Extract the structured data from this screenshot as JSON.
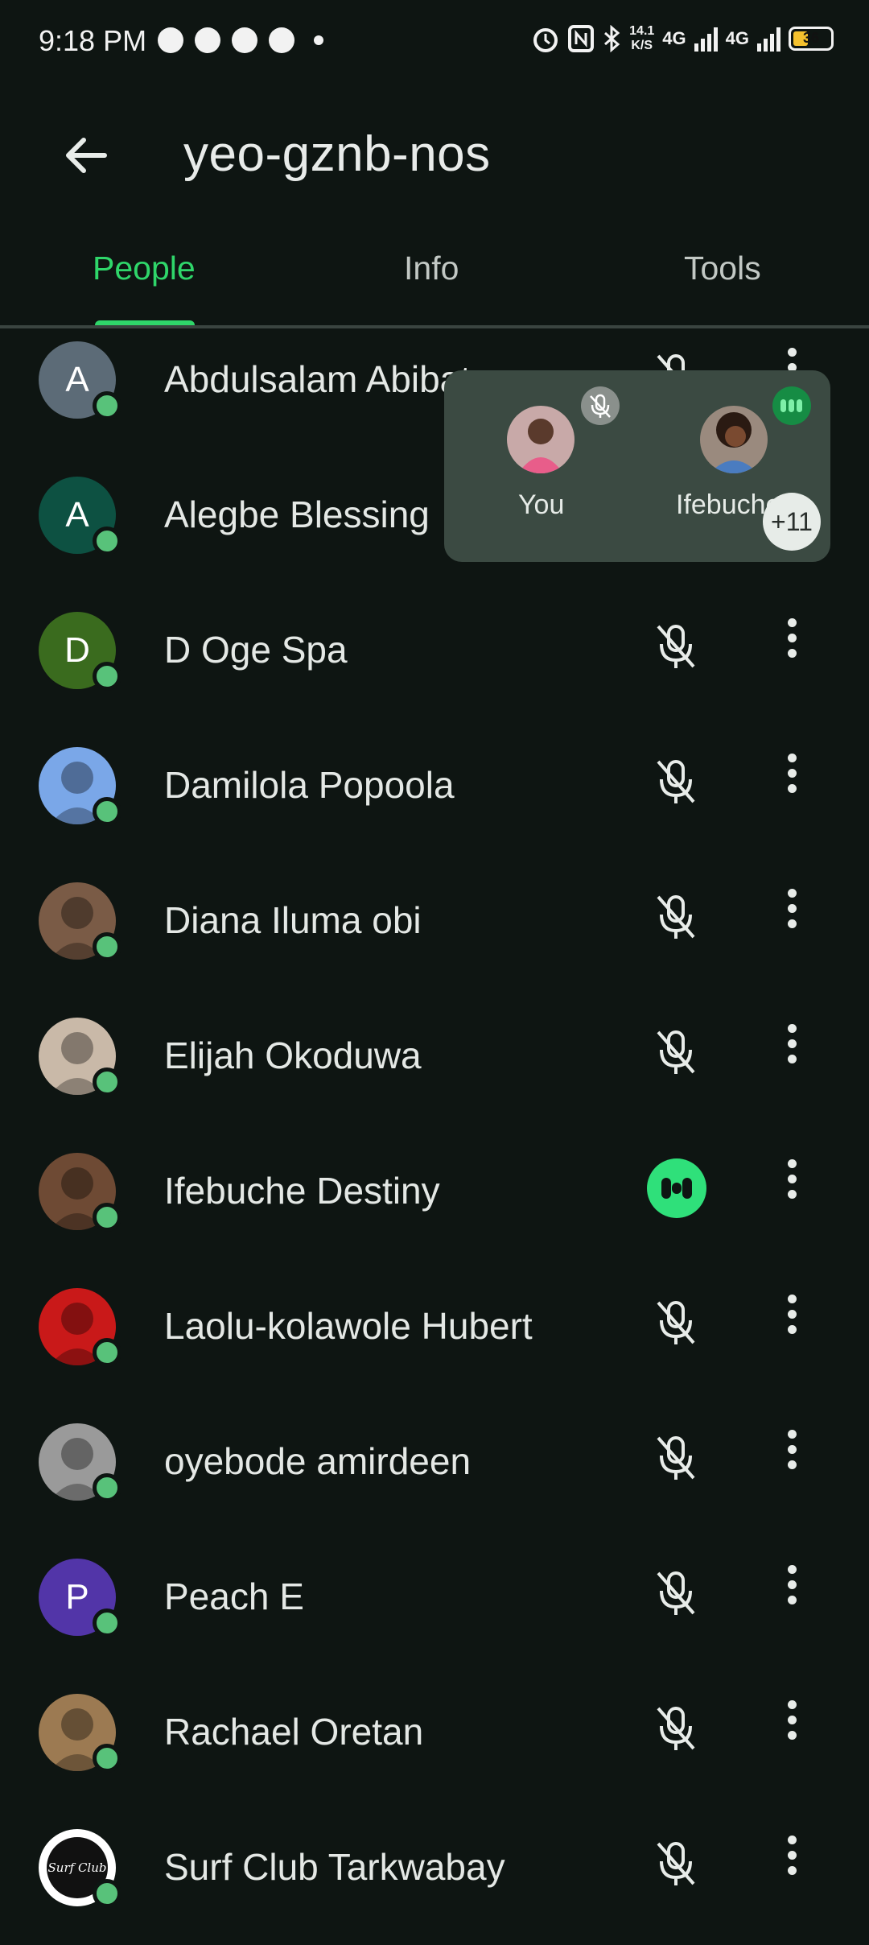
{
  "status_bar": {
    "time": "9:18 PM",
    "left_icons": [
      "message-icon",
      "snapchat-icon",
      "whatsapp-icon",
      "whatsapp-business-icon"
    ],
    "speed_value": "14.1",
    "speed_unit": "K/S",
    "net1": "4G",
    "net2": "4G",
    "battery_level": "36",
    "colors": {
      "battery_fill": "#f4c12e"
    }
  },
  "header": {
    "title": "yeo-gznb-nos",
    "back_icon": "arrow-left-icon"
  },
  "tabs": [
    {
      "label": "People",
      "active": true
    },
    {
      "label": "Info",
      "active": false
    },
    {
      "label": "Tools",
      "active": false
    }
  ],
  "people": [
    {
      "name": "Abdulsalam Abibat",
      "initial": "A",
      "avatar_color": "#5c6b77",
      "mic": "muted"
    },
    {
      "name": "Alegbe Blessing",
      "initial": "A",
      "avatar_color": "#0d5142",
      "mic": "muted"
    },
    {
      "name": "D Oge Spa",
      "initial": "D",
      "avatar_color": "#3a6b1e",
      "mic": "muted"
    },
    {
      "name": "Damilola Popoola",
      "initial": "",
      "avatar_color": "#7aa7e8",
      "mic": "muted"
    },
    {
      "name": "Diana Iluma obi",
      "initial": "",
      "avatar_color": "#7a5b46",
      "mic": "muted"
    },
    {
      "name": "Elijah Okoduwa",
      "initial": "",
      "avatar_color": "#c9b9a8",
      "mic": "muted"
    },
    {
      "name": "Ifebuche Destiny",
      "initial": "",
      "avatar_color": "#6e4a34",
      "mic": "speaking"
    },
    {
      "name": "Laolu-kolawole Hubert",
      "initial": "",
      "avatar_color": "#c91919",
      "mic": "muted"
    },
    {
      "name": "oyebode amirdeen",
      "initial": "",
      "avatar_color": "#9a9a9a",
      "mic": "muted"
    },
    {
      "name": "Peach E",
      "initial": "P",
      "avatar_color": "#5235a8",
      "mic": "muted"
    },
    {
      "name": "Rachael Oretan",
      "initial": "",
      "avatar_color": "#9c7a52",
      "mic": "muted"
    },
    {
      "name": "Surf Club Tarkwabay",
      "initial": "",
      "avatar_color": "#ffffff",
      "mic": "muted",
      "logo_text": "Surf Club"
    }
  ],
  "pip": {
    "tiles": [
      {
        "name": "You",
        "state": "muted"
      },
      {
        "name": "Ifebuche",
        "state": "speaking"
      }
    ],
    "overflow": "+11"
  },
  "colors": {
    "accent": "#2fd66a",
    "presence": "#58c27a",
    "background": "#0e1512",
    "pip_background": "#3b4a42"
  }
}
